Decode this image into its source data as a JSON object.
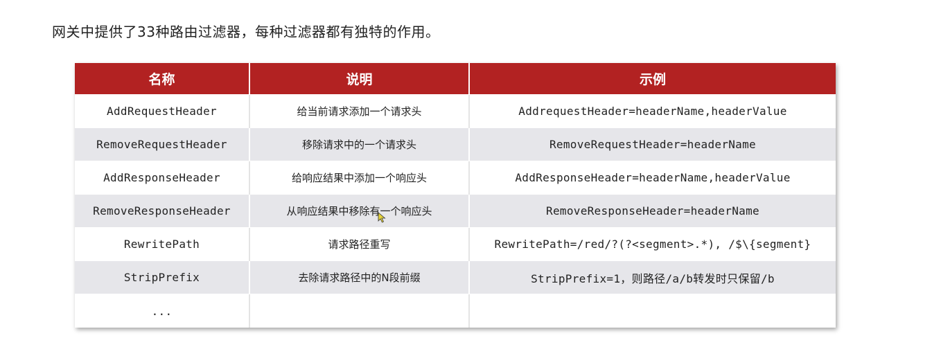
{
  "intro": "网关中提供了33种路由过滤器，每种过滤器都有独特的作用。",
  "table": {
    "headers": [
      "名称",
      "说明",
      "示例"
    ],
    "rows": [
      [
        "AddRequestHeader",
        "给当前请求添加一个请求头",
        "AddrequestHeader=headerName,headerValue"
      ],
      [
        "RemoveRequestHeader",
        "移除请求中的一个请求头",
        "RemoveRequestHeader=headerName"
      ],
      [
        "AddResponseHeader",
        "给响应结果中添加一个响应头",
        "AddResponseHeader=headerName,headerValue"
      ],
      [
        "RemoveResponseHeader",
        "从响应结果中移除有一个响应头",
        "RemoveResponseHeader=headerName"
      ],
      [
        "RewritePath",
        "请求路径重写",
        "RewritePath=/red/?(?<segment>.*), /$\\{segment}"
      ],
      [
        "StripPrefix",
        "去除请求路径中的N段前缀",
        "StripPrefix=1，则路径/a/b转发时只保留/b"
      ],
      [
        "...",
        "",
        ""
      ]
    ]
  },
  "colors": {
    "header_bg": "#b22222",
    "header_text": "#ffffff",
    "row_alt_bg": "#e6e6ea",
    "cursor": "#e5d33b"
  }
}
